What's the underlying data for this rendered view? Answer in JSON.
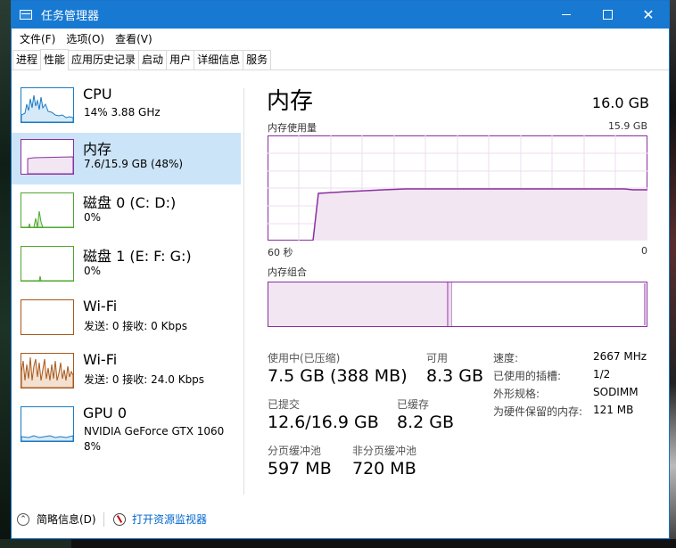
{
  "window": {
    "title": "任务管理器",
    "controls": {
      "minimize": "—",
      "maximize": "□",
      "close": "✕"
    }
  },
  "menu": [
    "文件(F)",
    "选项(O)",
    "查看(V)"
  ],
  "tabs": [
    "进程",
    "性能",
    "应用历史记录",
    "启动",
    "用户",
    "详细信息",
    "服务"
  ],
  "active_tab": "性能",
  "sidebar": [
    {
      "name": "CPU",
      "line1": "14% 3.88 GHz",
      "line2": "",
      "color": "#1b7ac4"
    },
    {
      "name": "内存",
      "line1": "7.6/15.9 GB (48%)",
      "line2": "",
      "color": "#8b2ea0",
      "selected": true
    },
    {
      "name": "磁盘 0 (C: D:)",
      "line1": "0%",
      "line2": "",
      "color": "#4ea72e"
    },
    {
      "name": "磁盘 1 (E: F: G:)",
      "line1": "0%",
      "line2": "",
      "color": "#4ea72e"
    },
    {
      "name": "Wi-Fi",
      "line1": "发送: 0 接收: 0 Kbps",
      "line2": "",
      "color": "#a7581b"
    },
    {
      "name": "Wi-Fi",
      "line1": "发送: 0 接收: 24.0 Kbps",
      "line2": "",
      "color": "#a7581b"
    },
    {
      "name": "GPU 0",
      "line1": "NVIDIA GeForce GTX 1060",
      "line2": "8%",
      "color": "#1b7ac4"
    }
  ],
  "memory": {
    "title": "内存",
    "total": "16.0 GB",
    "usage_label": "内存使用量",
    "usage_max": "15.9 GB",
    "axis_left": "60 秒",
    "axis_right": "0",
    "composition_label": "内存组合",
    "in_use_label": "使用中(已压缩)",
    "in_use_value": "7.5 GB (388 MB)",
    "available_label": "可用",
    "available_value": "8.3 GB",
    "committed_label": "已提交",
    "committed_value": "12.6/16.9 GB",
    "cached_label": "已缓存",
    "cached_value": "8.2 GB",
    "paged_label": "分页缓冲池",
    "paged_value": "597 MB",
    "nonpaged_label": "非分页缓冲池",
    "nonpaged_value": "720 MB",
    "details": [
      {
        "label": "速度:",
        "value": "2667 MHz"
      },
      {
        "label": "已使用的插槽:",
        "value": "1/2"
      },
      {
        "label": "外形规格:",
        "value": "SODIMM"
      },
      {
        "label": "为硬件保留的内存:",
        "value": "121 MB"
      }
    ]
  },
  "footer": {
    "fewer_details": "简略信息(D)",
    "open_monitor": "打开资源监视器"
  },
  "colors": {
    "memory": "#8b2ea0",
    "titlebar": "#1779d2",
    "selected": "#cce4f7"
  }
}
